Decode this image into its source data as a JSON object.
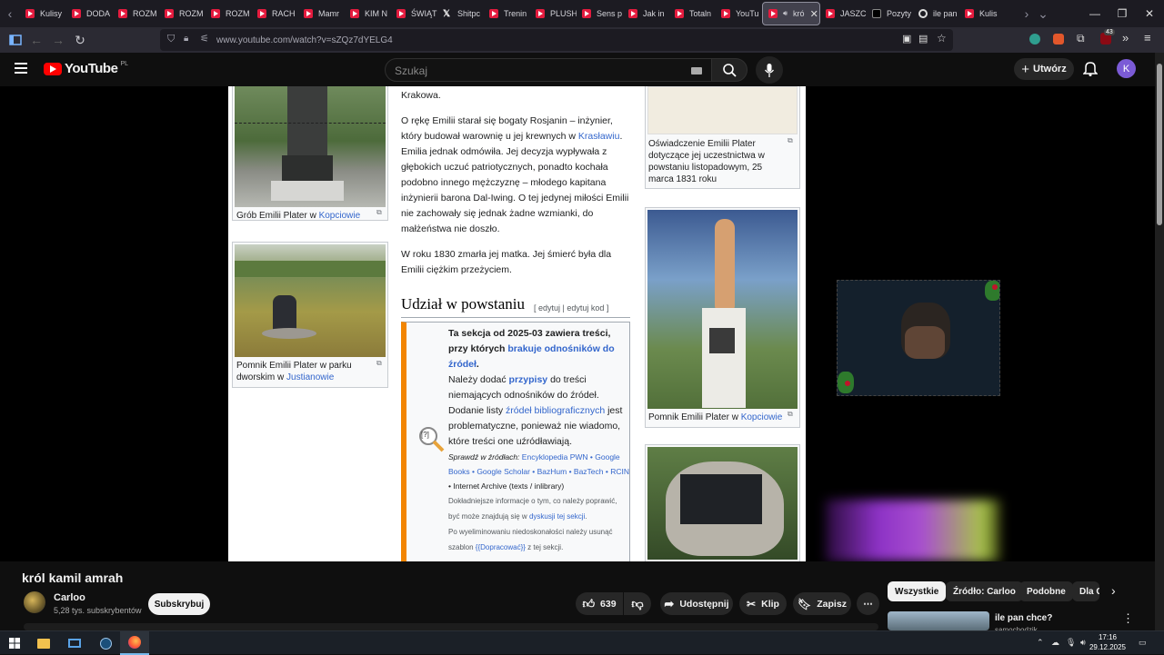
{
  "browser": {
    "tabs": [
      {
        "label": "Kulisy",
        "icon": "youtube-icon"
      },
      {
        "label": "DODA",
        "icon": "youtube-icon"
      },
      {
        "label": "ROZM",
        "icon": "youtube-icon"
      },
      {
        "label": "ROZM",
        "icon": "youtube-icon"
      },
      {
        "label": "ROZM",
        "icon": "youtube-icon"
      },
      {
        "label": "RACH",
        "icon": "youtube-icon"
      },
      {
        "label": "Mamr",
        "icon": "youtube-icon"
      },
      {
        "label": "KIM N",
        "icon": "youtube-icon"
      },
      {
        "label": "ŚWIĄT",
        "icon": "youtube-icon"
      },
      {
        "label": "Shitpc",
        "icon": "x-icon"
      },
      {
        "label": "Trenin",
        "icon": "youtube-icon"
      },
      {
        "label": "PLUSH",
        "icon": "youtube-icon"
      },
      {
        "label": "Sens p",
        "icon": "youtube-icon"
      },
      {
        "label": "Jak in",
        "icon": "youtube-icon"
      },
      {
        "label": "Totaln",
        "icon": "youtube-icon"
      },
      {
        "label": "YouTu",
        "icon": "youtube-icon"
      }
    ],
    "active_tab": {
      "label": "kró",
      "icon": "youtube-icon"
    },
    "tabs_after": [
      {
        "label": "JASZC",
        "icon": "youtube-icon"
      },
      {
        "label": "Pozyty",
        "icon": "tiktok-icon"
      },
      {
        "label": "ile pan",
        "icon": "circle-icon"
      },
      {
        "label": "Kulis",
        "icon": "youtube-icon"
      }
    ],
    "url": "www.youtube.com/watch?v=sZQz7dYELG4",
    "extension_badge": "43"
  },
  "youtube": {
    "logo_text": "YouTube",
    "logo_region": "PL",
    "search_placeholder": "Szukaj",
    "create_label": "Utwórz",
    "avatar_letter": "K"
  },
  "wiki": {
    "para_top": "Krakowa.",
    "para1_a": "O rękę Emilii starał się bogaty Rosjanin – inżynier, który budował warownię u jej krewnych w ",
    "para1_link": "Krasławiu",
    "para1_b": ". Emilia jednak odmówiła. Jej decyzja wypływała z głębokich uczuć patriotycznych, ponadto kochała podobno innego mężczyznę – młodego kapitana inżynierii barona Dal-Iwing. O tej jedynej miłości Emilii nie zachowały się jednak żadne wzmianki, do małżeństwa nie doszło.",
    "para2": "W roku 1830 zmarła jej matka. Jej śmierć była dla Emilii ciężkim przeżyciem.",
    "section_title": "Udział w powstaniu",
    "section_edit": "[ edytuj | edytuj kod ]",
    "amb_bold1": "Ta sekcja od 2025-03 zawiera treści, przy których ",
    "amb_link1": "brakuje odnośników do źródeł",
    "amb_dot": ".",
    "amb_l2a": "Należy dodać ",
    "amb_l2link": "przypisy",
    "amb_l2b": " do treści niemających odnośników do źródeł.",
    "amb_l3a": "Dodanie listy ",
    "amb_l3link": "źródeł bibliograficznych",
    "amb_l3b": " jest problematyczne, ponieważ nie wiadomo, które treści one uźródławiają.",
    "amb_check_label": "Sprawdź w źródłach:",
    "amb_check_links": "Encyklopedia PWN • Google Books • Google Scholar • BazHum • BazTech • RCIN",
    "amb_check_tail": " • Internet Archive (texts / inlibrary)",
    "amb_more1": "Dokładniejsze informacje o tym, co należy poprawić, być może znajdują się w ",
    "amb_more1_link": "dyskusji tej sekcji",
    "amb_more2": "Po wyeliminowaniu niedoskonałości należy usunąć szablon ",
    "amb_more2_link": "{{Dopracować}}",
    "amb_more2_tail": " z tej sekcji.",
    "amb_icon_text": "[?]",
    "cap_grave_a": "Grób Emilii Plater w ",
    "cap_grave_link": "Kopciowie",
    "cap_monument_a": "Pomnik Emilii Plater w parku dworskim w ",
    "cap_monument_link": "Justianowie",
    "cap_decl": "Oświadczenie Emilii Plater dotyczące jej uczestnictwa w powstaniu listopadowym, 25 marca 1831 roku",
    "cap_statue_a": "Pomnik Emilii Plater w ",
    "cap_statue_link": "Kopciowie"
  },
  "video": {
    "title": "król kamil amrah",
    "channel": "Carloo",
    "subscribers": "5,28 tys. subskrybentów",
    "subscribe_label": "Subskrybuj",
    "likes": "639",
    "share_label": "Udostępnij",
    "clip_label": "Klip",
    "save_label": "Zapisz"
  },
  "chips": [
    "Wszystkie",
    "Źródło: Carloo",
    "Podobne",
    "Dla C"
  ],
  "recommendation": {
    "title": "ile pan chce?",
    "channel": "samochodzik"
  },
  "system": {
    "time": "17:16",
    "date": "29.12.2025"
  }
}
